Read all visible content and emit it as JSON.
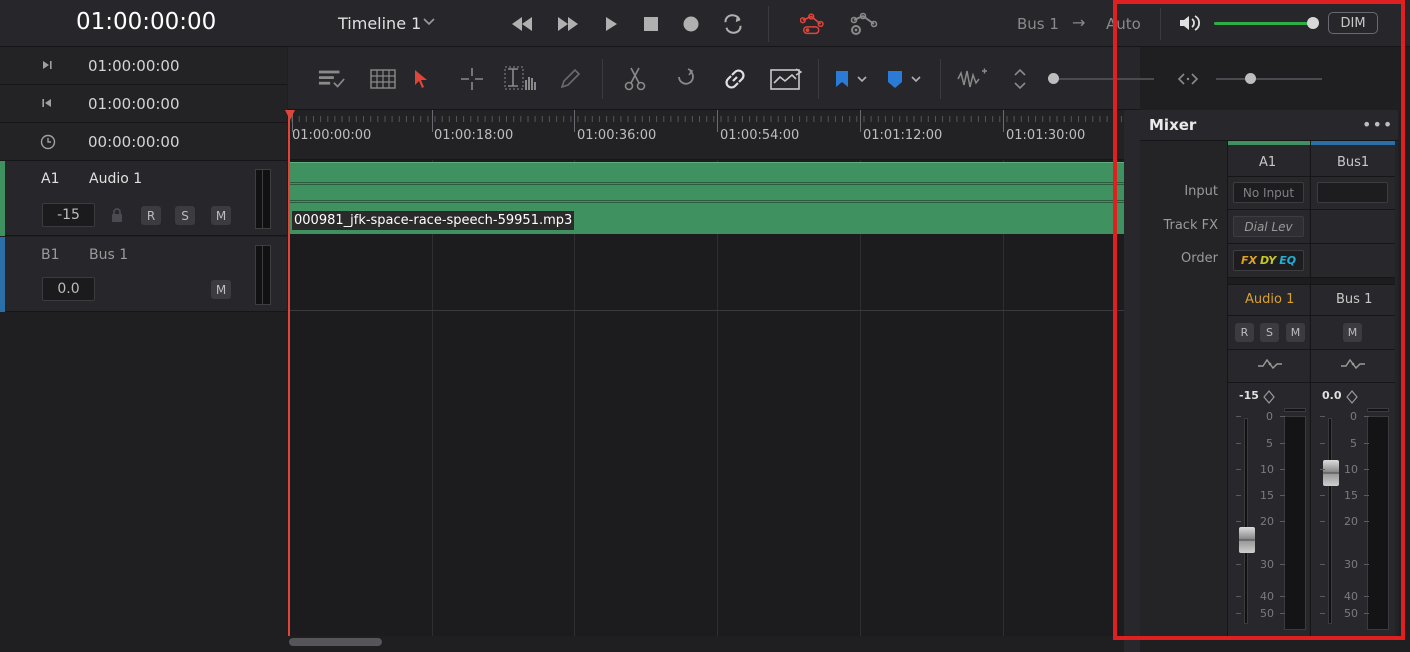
{
  "topbar": {
    "timecode": "01:00:00:00",
    "timeline_name": "Timeline 1",
    "bus_label": "Bus 1",
    "arrow": "→",
    "auto_label": "Auto",
    "dim_label": "DIM",
    "volume_level": 0.97
  },
  "timecodes": [
    {
      "icon": "go-to-end-icon",
      "value": "01:00:00:00"
    },
    {
      "icon": "go-to-start-icon",
      "value": "01:00:00:00"
    },
    {
      "icon": "clock-icon",
      "value": "00:00:00:00"
    }
  ],
  "tracks": [
    {
      "id": "A1",
      "name": "Audio 1",
      "volume": "-15",
      "buttons": [
        "R",
        "S",
        "M"
      ],
      "color": "#3f9160"
    },
    {
      "id": "B1",
      "name": "Bus 1",
      "volume": "0.0",
      "buttons": [
        "M"
      ],
      "color": "#2a6fa8"
    }
  ],
  "ruler": {
    "labels": [
      "01:00:00:00",
      "01:00:18:00",
      "01:00:36:00",
      "01:00:54:00",
      "01:01:12:00",
      "01:01:30:00"
    ]
  },
  "clip": {
    "name": "000981_jfk-space-race-speech-59951.mp3",
    "color": "#3f9160"
  },
  "mixer": {
    "title": "Mixer",
    "menu": "•••",
    "row_labels": {
      "input": "Input",
      "track_fx": "Track FX",
      "order": "Order"
    },
    "channels": [
      {
        "header": "A1",
        "input": "No Input",
        "track_fx": "Dial Lev",
        "order": {
          "fx": "FX",
          "dy": "DY",
          "eq": "EQ"
        },
        "name": "Audio 1",
        "buttons": [
          "R",
          "S",
          "M"
        ],
        "level": "-15",
        "color": "#3f9160"
      },
      {
        "header": "Bus1",
        "input": "",
        "name": "Bus 1",
        "buttons": [
          "M"
        ],
        "level": "0.0",
        "color": "#2a6fa8"
      }
    ],
    "scale": [
      "0",
      "5",
      "10",
      "15",
      "20",
      "30",
      "40",
      "50"
    ]
  }
}
